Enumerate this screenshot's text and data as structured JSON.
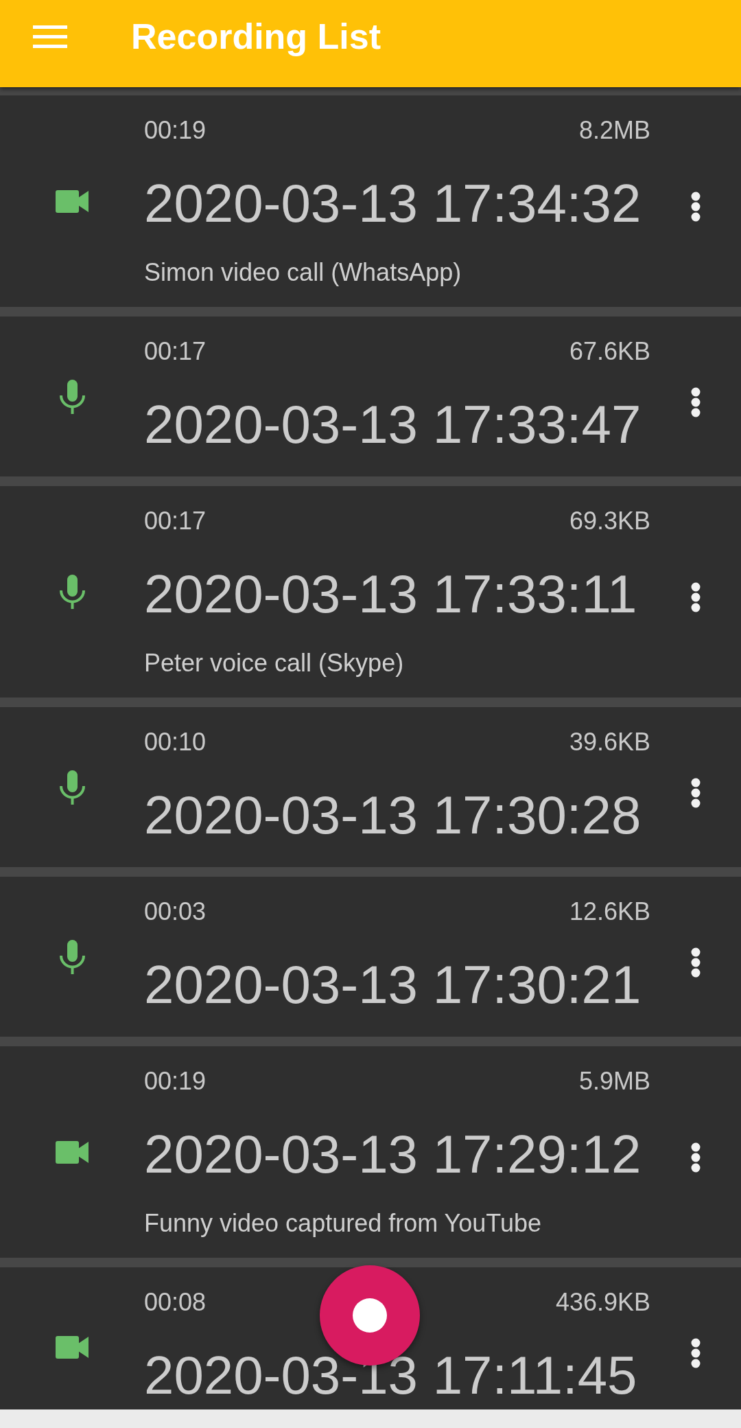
{
  "app_bar": {
    "title": "Recording List"
  },
  "recordings": [
    {
      "kind": "video",
      "duration": "00:19",
      "size": "8.2MB",
      "datetime": "2020-03-13 17:34:32",
      "note": "Simon video call (WhatsApp)"
    },
    {
      "kind": "audio",
      "duration": "00:17",
      "size": "67.6KB",
      "datetime": "2020-03-13 17:33:47"
    },
    {
      "kind": "audio",
      "duration": "00:17",
      "size": "69.3KB",
      "datetime": "2020-03-13 17:33:11",
      "note": "Peter voice call (Skype)"
    },
    {
      "kind": "audio",
      "duration": "00:10",
      "size": "39.6KB",
      "datetime": "2020-03-13 17:30:28"
    },
    {
      "kind": "audio",
      "duration": "00:03",
      "size": "12.6KB",
      "datetime": "2020-03-13 17:30:21"
    },
    {
      "kind": "video",
      "duration": "00:19",
      "size": "5.9MB",
      "datetime": "2020-03-13 17:29:12",
      "note": "Funny video captured from YouTube"
    },
    {
      "kind": "video",
      "duration": "00:08",
      "size": "436.9KB",
      "datetime": "2020-03-13 17:11:45"
    }
  ]
}
